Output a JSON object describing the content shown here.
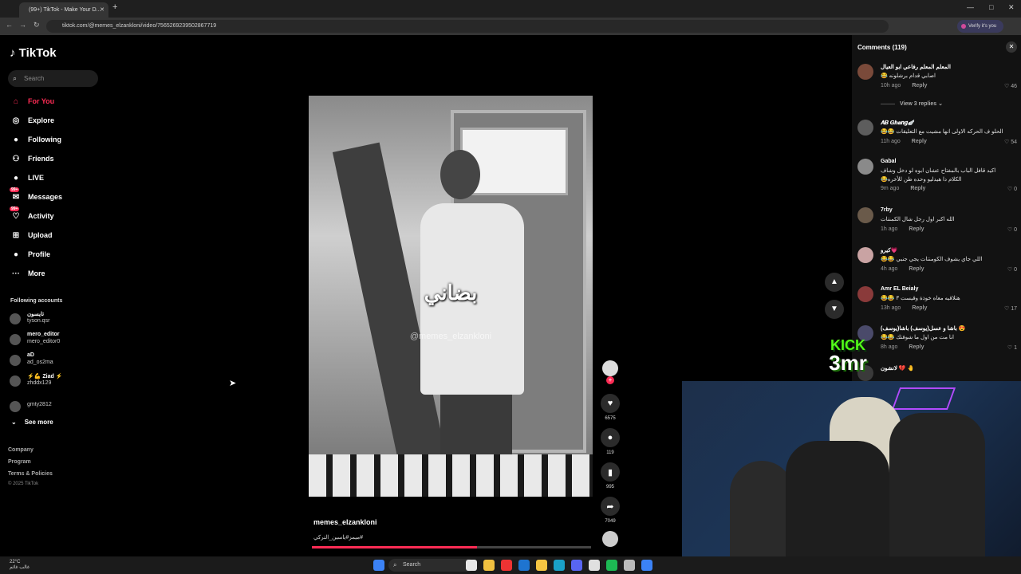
{
  "browser": {
    "tab_title": "(99+) TikTok - Make Your D...",
    "tab_close": "✕",
    "new_tab": "+",
    "url": "tiktok.com/@memes_elzankloni/video/7565269239502867719",
    "verify_label": "Verify it's you",
    "win_min": "—",
    "win_max": "□",
    "win_close": "✕",
    "back": "←",
    "forward": "→",
    "reload": "↻"
  },
  "sidebar": {
    "logo": "TikTok",
    "search_placeholder": "Search",
    "nav": [
      {
        "label": "For You",
        "icon": "home-icon",
        "glyph": "⌂"
      },
      {
        "label": "Explore",
        "icon": "compass-icon",
        "glyph": "◎"
      },
      {
        "label": "Following",
        "icon": "following-avatar-icon",
        "glyph": "●"
      },
      {
        "label": "Friends",
        "icon": "friends-icon",
        "glyph": "⚇"
      },
      {
        "label": "LIVE",
        "icon": "live-avatar-icon",
        "glyph": "●"
      },
      {
        "label": "Messages",
        "icon": "messages-icon",
        "glyph": "✉",
        "badge": "99+"
      },
      {
        "label": "Activity",
        "icon": "activity-icon",
        "glyph": "♡",
        "badge": "99+"
      },
      {
        "label": "Upload",
        "icon": "upload-icon",
        "glyph": "⊞"
      },
      {
        "label": "Profile",
        "icon": "profile-avatar-icon",
        "glyph": "●"
      },
      {
        "label": "More",
        "icon": "more-icon",
        "glyph": "···"
      }
    ],
    "following_title": "Following accounts",
    "following": [
      {
        "name": "تايسون",
        "handle": "tyson.qsr"
      },
      {
        "name": "mero_editor",
        "handle": "mero_editor0"
      },
      {
        "name": "aD",
        "handle": "ad_os2ma"
      },
      {
        "name": "⚡💪 Ziad ⚡",
        "handle": "zhddx129"
      },
      {
        "name": "",
        "handle": "gmty2812"
      }
    ],
    "see_more": "See more",
    "footer": [
      "Company",
      "Program",
      "Terms & Policies"
    ],
    "copyright": "© 2025 TikTok"
  },
  "video": {
    "caption_overlay": "بضاني",
    "watermark": "@memes_elzankloni",
    "author": "memes_elzankloni",
    "hashtags": "ميمز#ياسين_التركي#",
    "progress_fraction": 0.59
  },
  "actions": {
    "likes": "6575",
    "comments": "119",
    "saves": "995",
    "shares": "7049"
  },
  "comments_panel": {
    "title": "Comments (119)",
    "view_replies": "View 3 replies ⌄",
    "reply_label": "Reply",
    "items": [
      {
        "name": "المعلم المعلم رفاعي ابو العيال",
        "text": "اصابي قدام برشلونه 😂",
        "time": "10h ago",
        "likes": "46"
      },
      {
        "name": "𝑨𝑩 𝑮𝒉𝒂𝒏𝒈🪽",
        "text": "الحلو ف الحركه الاولى انها مشيت مع التعليقات 😂😂",
        "time": "11h ago",
        "likes": "54"
      },
      {
        "name": "Gabal",
        "text": "اكيد قافل الباب بالمفتاح عشان ابوه لو دخل وشاف الكلام دا هيدليو وحده طن للأخره😂",
        "time": "9m ago",
        "likes": "0"
      },
      {
        "name": "7rby",
        "text": "الله اكبر اول رجل شال الكمنتات",
        "time": "1h ago",
        "likes": "0"
      },
      {
        "name": "كيرو💗",
        "text": "اللي جاي يشوف الكومنتات يجي جنبي 😂😂",
        "time": "4h ago",
        "likes": "0"
      },
      {
        "name": "Amr EL Beialy",
        "text": "هتلاقيه معاه خوذة وقيست ٣ 😂😂",
        "time": "13h ago",
        "likes": "17"
      },
      {
        "name": "باشا و عسل(يوسف) باشا(يوسف) 😍",
        "text": "انا مت من اول ما شوفتك 😂😂",
        "time": "8h ago",
        "likes": "1"
      },
      {
        "name": "لانشون 💔 🤚",
        "text": "",
        "time": "",
        "likes": ""
      }
    ]
  },
  "stream_overlay": {
    "kick_text": "KICK",
    "channel_text": "3mr"
  },
  "taskbar": {
    "weather_temp": "22°C",
    "weather_desc": "غالب غائم",
    "search_label": "Search"
  },
  "colors": {
    "accent": "#fe2c55",
    "kick": "#53fc18"
  }
}
